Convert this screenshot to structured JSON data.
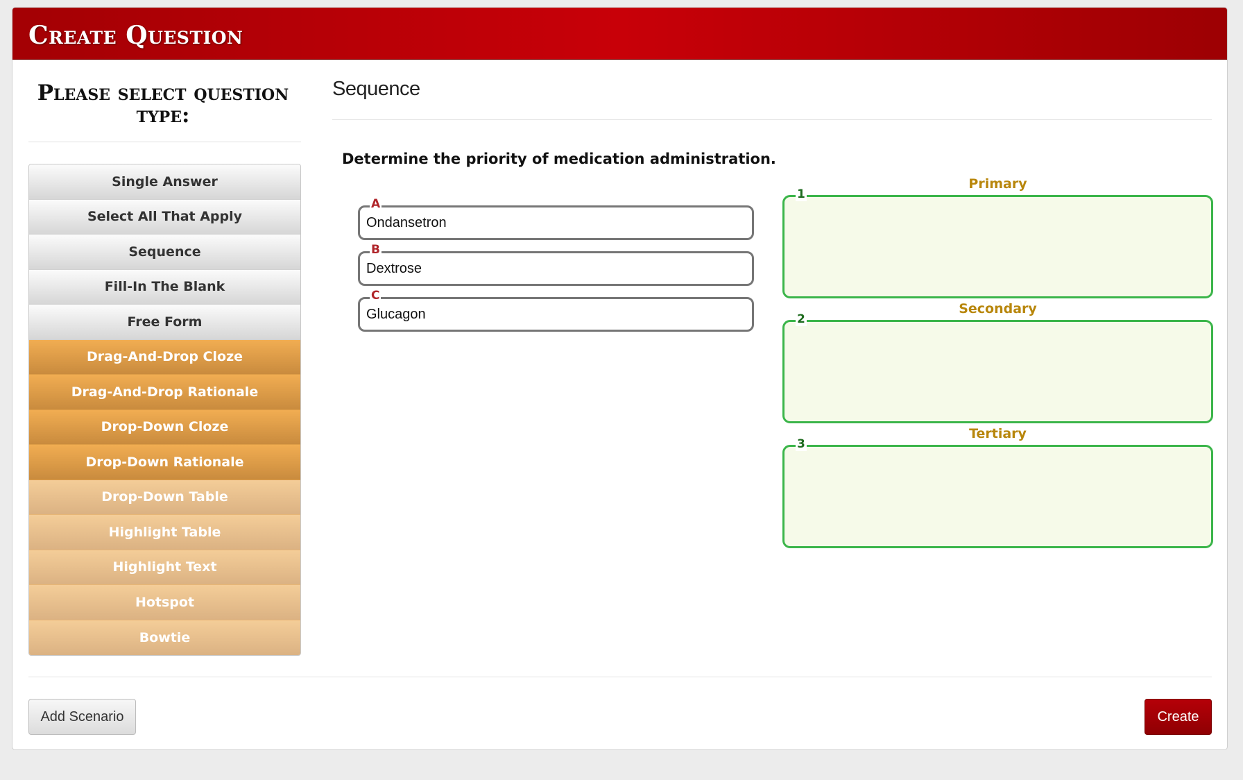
{
  "header": {
    "title": "Create Question"
  },
  "left_panel": {
    "title": "Please select question type:",
    "question_types": [
      {
        "label": "Single Answer",
        "style": "gray"
      },
      {
        "label": "Select All That Apply",
        "style": "gray"
      },
      {
        "label": "Sequence",
        "style": "gray"
      },
      {
        "label": "Fill-In The Blank",
        "style": "gray"
      },
      {
        "label": "Free Form",
        "style": "gray"
      },
      {
        "label": "Drag-And-Drop Cloze",
        "style": "orange"
      },
      {
        "label": "Drag-And-Drop Rationale",
        "style": "orange"
      },
      {
        "label": "Drop-Down Cloze",
        "style": "orange"
      },
      {
        "label": "Drop-Down Rationale",
        "style": "orange"
      },
      {
        "label": "Drop-Down Table",
        "style": "tan"
      },
      {
        "label": "Highlight Table",
        "style": "tan"
      },
      {
        "label": "Highlight Text",
        "style": "tan"
      },
      {
        "label": "Hotspot",
        "style": "tan"
      },
      {
        "label": "Bowtie",
        "style": "tan"
      }
    ]
  },
  "main": {
    "question_type_title": "Sequence",
    "question_text": "Determine the priority of medication administration.",
    "options": [
      {
        "letter": "A",
        "text": "Ondansetron"
      },
      {
        "letter": "B",
        "text": "Dextrose"
      },
      {
        "letter": "C",
        "text": "Glucagon"
      }
    ],
    "slots": [
      {
        "label": "Primary",
        "number": "1"
      },
      {
        "label": "Secondary",
        "number": "2"
      },
      {
        "label": "Tertiary",
        "number": "3"
      }
    ]
  },
  "footer": {
    "add_scenario_label": "Add Scenario",
    "create_label": "Create"
  },
  "colors": {
    "header_red": "#c80008",
    "option_letter": "#b0252a",
    "slot_label": "#b8860b",
    "slot_border": "#3bb54a",
    "slot_fill": "#f6fae9",
    "orange_button": "#e3a04c",
    "tan_button": "#eac08c"
  }
}
